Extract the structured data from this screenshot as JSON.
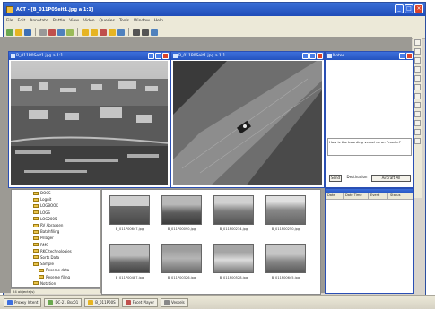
{
  "app": {
    "title": "ACT - [B_011P0Seit1.jpg a 1:1]"
  },
  "menu": [
    "File",
    "Edit",
    "Annotate",
    "Battle",
    "View",
    "Video",
    "Queries",
    "Tools",
    "Window",
    "Help"
  ],
  "toolbar": {
    "icons": [
      "new-icon",
      "open-icon",
      "save-icon",
      "print-icon",
      "cut-icon",
      "copy-icon",
      "paste-icon",
      "undo-icon",
      "folder-icon",
      "image-icon",
      "video-icon",
      "map-icon",
      "zoom-in-icon",
      "zoom-out-icon",
      "grid-icon",
      "help-icon"
    ]
  },
  "windows": {
    "left": {
      "title": "B_011P0Seit1.jpg a 1:1"
    },
    "middle": {
      "title": "B_011P0Seit1.jpg a 1:1"
    },
    "notes": {
      "title": "Notes",
      "question": "How is the boarding vessel as on Prowler?",
      "send_label": "Send",
      "destination_label": "Destination",
      "destination_value": "Aircraft All",
      "table_headers": [
        "Date",
        "Date Time",
        "Event",
        "Status"
      ]
    }
  },
  "tree": {
    "items": [
      "DOCS",
      "Loguit",
      "LOGBOOK",
      "LOGS",
      "LOG2005",
      "RV Abraxsen",
      "Batchfiling",
      "Pillager",
      "RMS",
      "RKC technologies",
      "Sorts Data",
      "Sample",
      "Reseme data",
      "Reseme filing",
      "Notation"
    ],
    "status": "24 objects(s)"
  },
  "thumbnails": [
    {
      "label": "B_011P00647.jpg"
    },
    {
      "label": "B_011P00090.jpg"
    },
    {
      "label": "B_011P00234.jpg"
    },
    {
      "label": "B_011P00250.jpg"
    },
    {
      "label": "B_011P00487.jpg"
    },
    {
      "label": "B_011P00326.jpg"
    },
    {
      "label": "B_011P00528.jpg"
    },
    {
      "label": "B_011P00645.jpg"
    }
  ],
  "taskbar": {
    "items": [
      "Proxxy Intent",
      "DC-21 Bsc01",
      "B_011P00S",
      "Facet Player",
      "Vessels"
    ]
  },
  "colors": {
    "title_blue": "#1f4cb8",
    "window_border": "#2a4fb4",
    "close_red": "#d9442b"
  }
}
